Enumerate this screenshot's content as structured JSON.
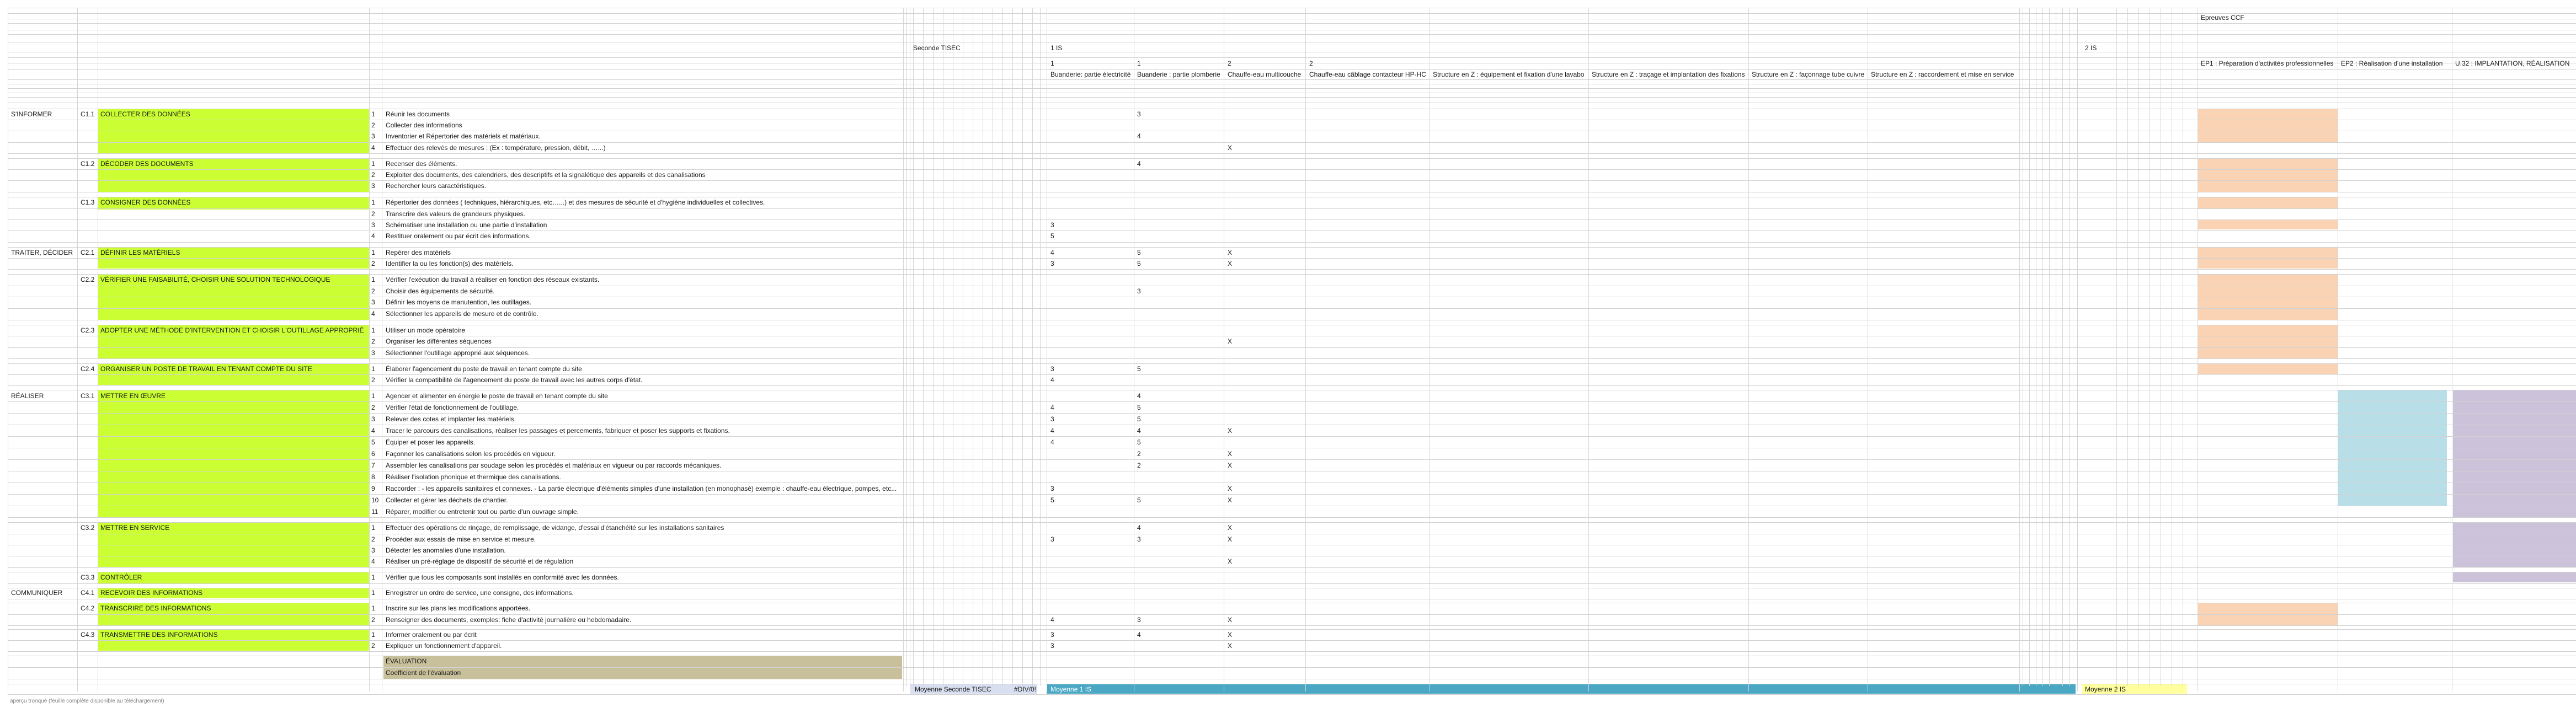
{
  "sheet": {
    "top_header": "Epreuves CCF",
    "level_seconde": "Seconde TISEC",
    "level_1is": "1 IS",
    "level_2is": "2 IS",
    "col_nums": [
      "1",
      "1",
      "2",
      "2"
    ],
    "activities": [
      "Buanderie: partie électricité",
      "Buanderie : partie plomberie",
      "Chauffe-eau multicouche",
      "Chauffe-eau câblage contacteur HP-HC",
      "Structure en Z : équipement et fixation d'une lavabo",
      "Structure en Z : traçage et implantation des fixations",
      "Structure en Z : façonnage tube cuivre",
      "Structure en Z : raccordement et mise en service"
    ],
    "epreuves": [
      "EP1 : Préparation d'activités professionnelles",
      "EP2 : Réalisation d'une installation",
      "U.32 : IMPLANTATION, RÉALISATION"
    ],
    "evaluation": "ÉVALUATION",
    "coefficient": "Coefficient de l'évaluation",
    "avg_seconde": "Moyenne Seconde TISEC",
    "avg_seconde_value": "#DIV/0!",
    "avg_1is": "Moyenne 1 IS",
    "avg_2is": "Moyenne 2 IS",
    "footer": "aperçu tronqué (feuille complète disponible au téléchargement)"
  },
  "domains": [
    "S'INFORMER",
    "TRAITER, DÉCIDER",
    "RÉALISER",
    "COMMUNIQUER"
  ],
  "competences": [
    {
      "code": "C1.1",
      "label": "COLLECTER DES DONNÉES"
    },
    {
      "code": "C1.2",
      "label": "DÉCODER DES DOCUMENTS"
    },
    {
      "code": "C1.3",
      "label": "CONSIGNER DES DONNÉES"
    },
    {
      "code": "C2.1",
      "label": "DÉFINIR LES MATÉRIELS"
    },
    {
      "code": "C2.2",
      "label": "VÉRIFIER UNE FAISABILITÉ, CHOISIR UNE SOLUTION TECHNOLOGIQUE"
    },
    {
      "code": "C2.3",
      "label": "ADOPTER UNE MÉTHODE D'INTERVENTION ET CHOISIR L'OUTILLAGE APPROPRIÉ"
    },
    {
      "code": "C2.4",
      "label": "ORGANISER UN POSTE DE TRAVAIL EN TENANT COMPTE DU SITE"
    },
    {
      "code": "C3.1",
      "label": "METTRE EN ŒUVRE"
    },
    {
      "code": "C3.2",
      "label": "METTRE EN SERVICE"
    },
    {
      "code": "C3.3",
      "label": "CONTRÔLER"
    },
    {
      "code": "C4.1",
      "label": "RECEVOIR DES INFORMATIONS"
    },
    {
      "code": "C4.2",
      "label": "TRANSCRIRE DES INFORMATIONS"
    },
    {
      "code": "C4.3",
      "label": "TRANSMETTRE DES INFORMATIONS"
    }
  ],
  "rows": [
    {
      "n": "1",
      "text": "Réunir les documents",
      "c2": "3"
    },
    {
      "n": "2",
      "text": "Collecter des informations"
    },
    {
      "n": "3",
      "text": "Inventorier et Répertorier des matériels et matériaux.",
      "c2": "4"
    },
    {
      "n": "4",
      "text": "Effectuer des relevés de mesures : (Ex : température, pression, débit, …...)",
      "c3": "X"
    },
    {
      "n": "1",
      "text": "Recenser des éléments.",
      "c2": "4"
    },
    {
      "n": "2",
      "text": "Exploiter des documents, des calendriers, des descriptifs et la signalétique des appareils et des canalisations"
    },
    {
      "n": "3",
      "text": "Rechercher leurs caractéristiques."
    },
    {
      "n": "1",
      "text": "Répertorier des données ( techniques, hiérarchiques, etc…...) et des mesures de sécurité et d'hygiène individuelles et collectives."
    },
    {
      "n": "2",
      "text": "Transcrire des valeurs de grandeurs physiques."
    },
    {
      "n": "3",
      "text": "Schématiser une installation ou une partie d'installation",
      "c1": "3"
    },
    {
      "n": "4",
      "text": "Restituer oralement ou par écrit des informations.",
      "c1": "5"
    },
    {
      "n": "1",
      "text": "Repérer des matériels",
      "c1": "4",
      "c2": "5",
      "c3": "X"
    },
    {
      "n": "2",
      "text": "Identifier la ou les fonction(s) des matériels.",
      "c1": "3",
      "c2": "5",
      "c3": "X"
    },
    {
      "n": "1",
      "text": "Vérifier l'exécution du travail à réaliser en fonction des réseaux existants."
    },
    {
      "n": "2",
      "text": "Choisir des équipements de sécurité.",
      "c2": "3"
    },
    {
      "n": "3",
      "text": "Définir les moyens de manutention, les outillages."
    },
    {
      "n": "4",
      "text": "Sélectionner les appareils de mesure et de contrôle."
    },
    {
      "n": "1",
      "text": "Utiliser un mode opératoire"
    },
    {
      "n": "2",
      "text": "Organiser les différentes séquences",
      "c3": "X"
    },
    {
      "n": "3",
      "text": "Sélectionner l'outillage approprié aux séquences."
    },
    {
      "n": "1",
      "text": "Élaborer l'agencement du poste de travail en tenant compte du site",
      "c1": "3",
      "c2": "5"
    },
    {
      "n": "2",
      "text": "Vérifier la compatibilité de l'agencement du poste de travail avec les autres corps d'état.",
      "c1": "4"
    },
    {
      "n": "1",
      "text": "Agencer et alimenter en énergie le poste de travail en tenant compte du site",
      "c2": "4"
    },
    {
      "n": "2",
      "text": "Vérifier l'état de fonctionnement de l'outillage.",
      "c1": "4",
      "c2": "5"
    },
    {
      "n": "3",
      "text": "Relever des cotes et implanter les matériels.",
      "c1": "3",
      "c2": "5"
    },
    {
      "n": "4",
      "text": "Tracer le parcours des canalisations, réaliser les passages et percements, fabriquer et poser les supports et fixations.",
      "c1": "4",
      "c2": "4",
      "c3": "X"
    },
    {
      "n": "5",
      "text": "Équiper et poser les appareils.",
      "c1": "4",
      "c2": "5"
    },
    {
      "n": "6",
      "text": "Façonner les canalisations selon les procédés en vigueur.",
      "c2": "2",
      "c3": "X"
    },
    {
      "n": "7",
      "text": "Assembler les canalisations par soudage selon les procédés et matériaux en vigueur ou par raccords mécaniques.",
      "c2": "2",
      "c3": "X"
    },
    {
      "n": "8",
      "text": "Réaliser l'isolation phonique et thermique des canalisations."
    },
    {
      "n": "9",
      "text": "Raccorder : - les appareils sanitaires et connexes. - La partie électrique d'éléments simples d'une installation (en monophasé) exemple : chauffe-eau électrique, pompes, etc...",
      "c1": "3",
      "c3": "X"
    },
    {
      "n": "10",
      "text": "Collecter et gérer les déchets de chantier.",
      "c1": "5",
      "c2": "5",
      "c3": "X"
    },
    {
      "n": "11",
      "text": "Réparer, modifier ou entretenir tout ou partie d'un ouvrage simple."
    },
    {
      "n": "1",
      "text": "Effectuer des opérations de rinçage, de remplissage, de vidange, d'essai d'étanchéité sur les installations sanitaires",
      "c2": "4",
      "c3": "X"
    },
    {
      "n": "2",
      "text": "Procéder aux essais de mise en service et mesure.",
      "c1": "3",
      "c2": "3",
      "c3": "X"
    },
    {
      "n": "3",
      "text": "Détecter les anomalies d'une installation."
    },
    {
      "n": "4",
      "text": "Réaliser un pré-réglage de dispositif de sécurité et de régulation",
      "c3": "X"
    },
    {
      "n": "1",
      "text": "Vérifier que tous les composants sont installés en conformité avec les données."
    },
    {
      "n": "1",
      "text": "Enregistrer un ordre de service, une consigne, des informations."
    },
    {
      "n": "1",
      "text": "Inscrire sur les plans les modifications apportées."
    },
    {
      "n": "2",
      "text": "Renseigner des documents, exemples: fiche d'activité journalière ou hebdomadaire.",
      "c1": "4",
      "c2": "3",
      "c3": "X"
    },
    {
      "n": "1",
      "text": "Informer oralement ou par écrit",
      "c1": "3",
      "c2": "4",
      "c3": "X"
    },
    {
      "n": "2",
      "text": "Expliquer un fonctionnement d'appareil.",
      "c1": "3",
      "c3": "X"
    }
  ]
}
